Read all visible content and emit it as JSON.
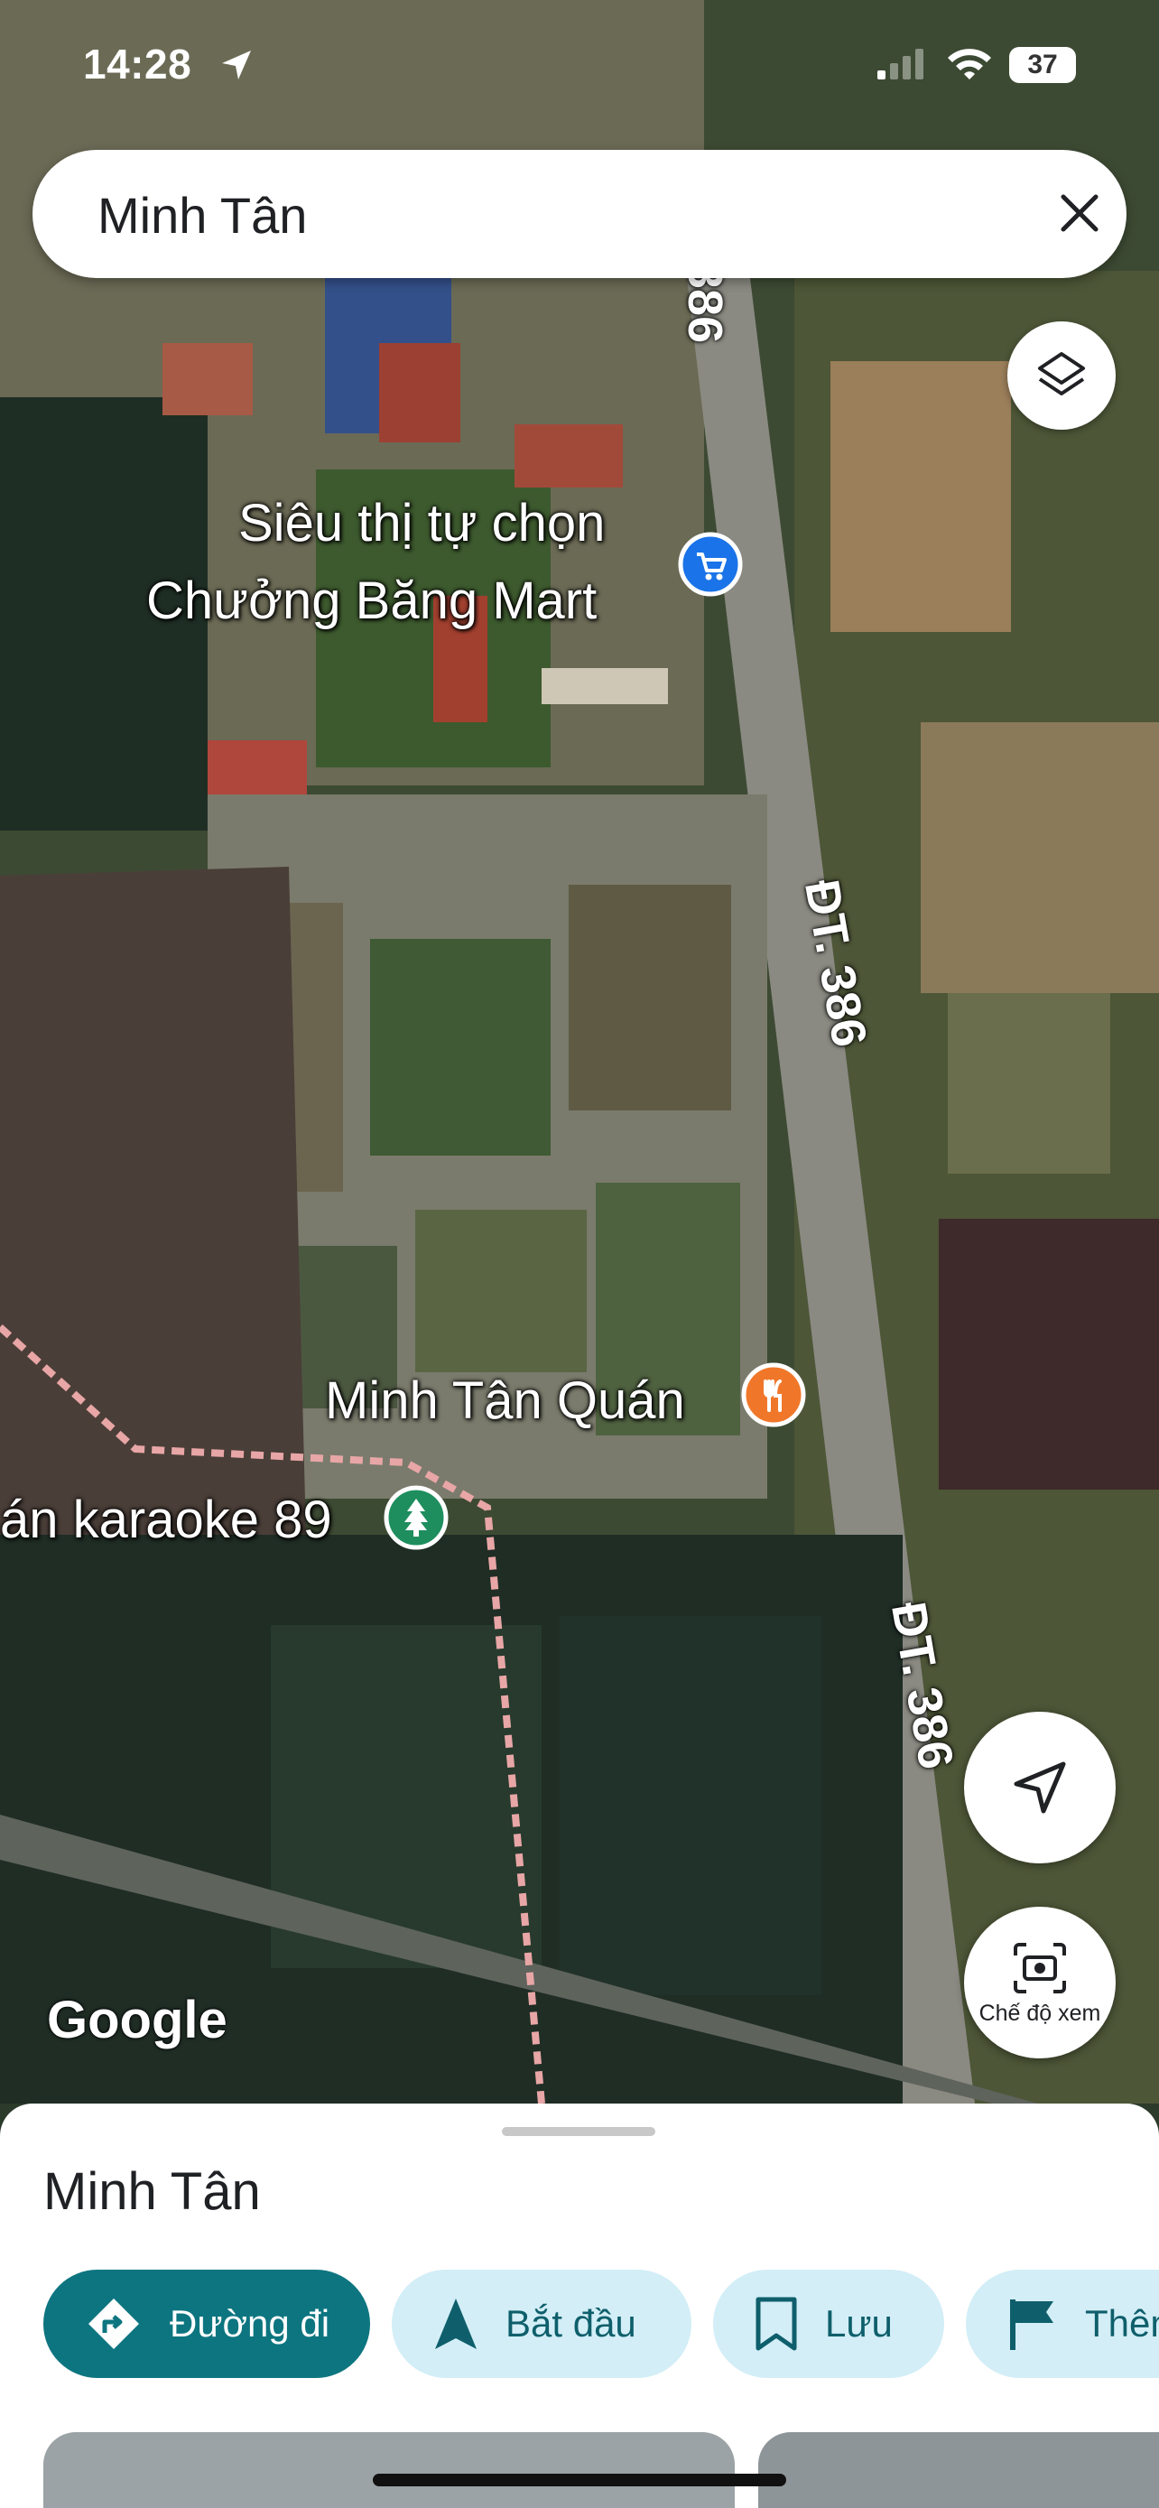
{
  "status_bar": {
    "time": "14:28",
    "battery": "37"
  },
  "search": {
    "query": "Minh Tân"
  },
  "map": {
    "places": [
      {
        "line1": "Siêu thị tự chọn",
        "line2": "Chưởng Băng Mart",
        "icon": "cart-icon",
        "color": "#1a73e8"
      },
      {
        "name": "Minh Tân Quán",
        "icon": "restaurant-icon",
        "color": "#f0772a"
      },
      {
        "name": "án karaoke 89",
        "icon": "tree-icon",
        "color": "#1e8e5e"
      }
    ],
    "roads": [
      "386",
      "ĐT. 386",
      "ĐT. 386"
    ],
    "attribution": "Google"
  },
  "controls": {
    "view_mode_label": "Chế độ xem"
  },
  "sheet": {
    "title": "Minh Tân",
    "actions": [
      {
        "label": "Đường đi",
        "icon": "directions-icon"
      },
      {
        "label": "Bắt đầu",
        "icon": "navigation-arrow-icon"
      },
      {
        "label": "Lưu",
        "icon": "bookmark-icon"
      },
      {
        "label": "Thêm",
        "icon": "flag-icon"
      }
    ]
  }
}
